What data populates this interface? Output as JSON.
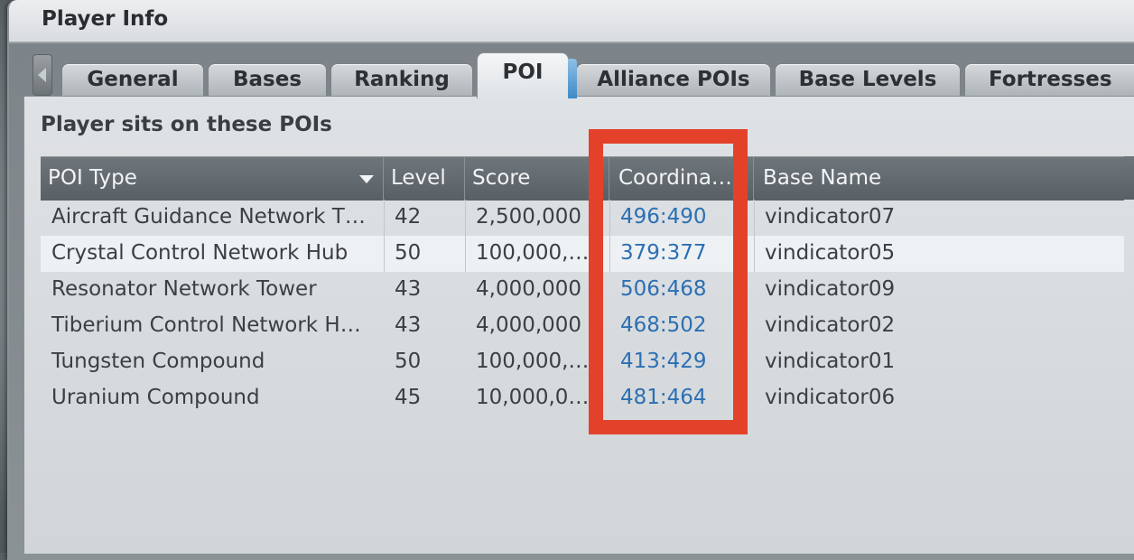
{
  "window": {
    "title": "Player Info"
  },
  "tabs": [
    {
      "label": "General",
      "active": false
    },
    {
      "label": "Bases",
      "active": false
    },
    {
      "label": "Ranking",
      "active": false
    },
    {
      "label": "POI",
      "active": true
    },
    {
      "label": "Alliance POIs",
      "active": false
    },
    {
      "label": "Base Levels",
      "active": false
    },
    {
      "label": "Fortresses an",
      "active": false
    }
  ],
  "panel": {
    "heading": "Player sits on these POIs"
  },
  "table": {
    "columns": [
      "POI Type",
      "Level",
      "Score",
      "Coordina…",
      "Base Name"
    ],
    "rows": [
      {
        "poi_type": "Aircraft Guidance Network T…",
        "level": "42",
        "score": "2,500,000",
        "coordinates": "496:490",
        "base_name": "vindicator07"
      },
      {
        "poi_type": "Crystal Control Network Hub",
        "level": "50",
        "score": "100,000,…",
        "coordinates": "379:377",
        "base_name": "vindicator05"
      },
      {
        "poi_type": "Resonator Network Tower",
        "level": "43",
        "score": "4,000,000",
        "coordinates": "506:468",
        "base_name": "vindicator09"
      },
      {
        "poi_type": "Tiberium Control Network H…",
        "level": "43",
        "score": "4,000,000",
        "coordinates": "468:502",
        "base_name": "vindicator02"
      },
      {
        "poi_type": "Tungsten Compound",
        "level": "50",
        "score": "100,000,…",
        "coordinates": "413:429",
        "base_name": "vindicator01"
      },
      {
        "poi_type": "Uranium Compound",
        "level": "45",
        "score": "10,000,0…",
        "coordinates": "481:464",
        "base_name": "vindicator06"
      }
    ],
    "selected_row": 1
  },
  "annotation": {
    "color": "#e4412b",
    "target": "coordinates-column"
  },
  "colors": {
    "link": "#2c6fb3",
    "header_bg": "#596065",
    "panel_bg": "#dfe2e5"
  }
}
